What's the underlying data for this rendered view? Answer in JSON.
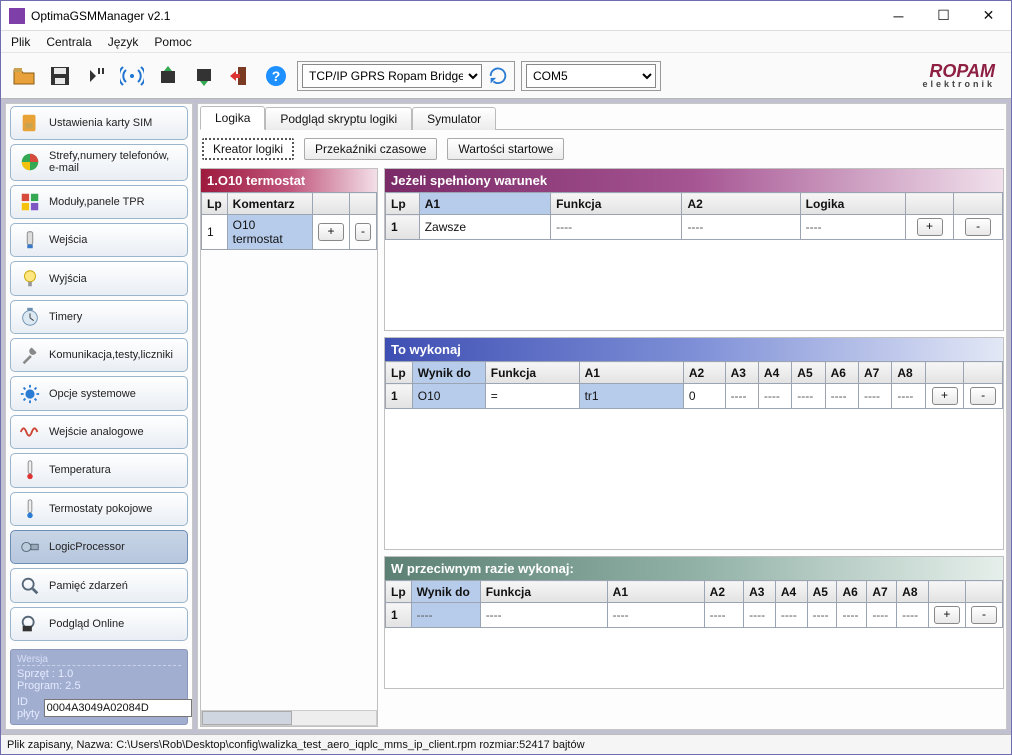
{
  "window": {
    "title": "OptimaGSMManager v2.1"
  },
  "menu": {
    "items": [
      "Plik",
      "Centrala",
      "Język",
      "Pomoc"
    ]
  },
  "toolbar": {
    "conn_select": "TCP/IP GPRS Ropam Bridge",
    "com_select": "COM5",
    "brand_top": "ROPAM",
    "brand_bot": "elektronik"
  },
  "sidebar": {
    "items": [
      "Ustawienia karty SIM",
      "Strefy,numery telefonów, e-mail",
      "Moduły,panele TPR",
      "Wejścia",
      "Wyjścia",
      "Timery",
      "Komunikacja,testy,liczniki",
      "Opcje systemowe",
      "Wejście analogowe",
      "Temperatura",
      "Termostaty pokojowe",
      "LogicProcessor",
      "Pamięć zdarzeń",
      "Podgląd Online"
    ],
    "active_index": 11
  },
  "version": {
    "group": "Wersja",
    "hw": "Sprzęt : 1.0",
    "sw": "Program: 2.5",
    "id_label": "ID płyty",
    "id_value": "0004A3049A02084D"
  },
  "tabs": {
    "names": [
      "Logika",
      "Podgląd skryptu logiki",
      "Symulator"
    ],
    "active": 0
  },
  "subtabs": {
    "names": [
      "Kreator logiki",
      "Przekaźniki czasowe",
      "Wartości startowe"
    ],
    "active": 0
  },
  "left_panel": {
    "title": "1.O10 termostat",
    "cols": [
      "Lp",
      "Komentarz"
    ],
    "row": {
      "lp": "1",
      "comment": "O10 termostat"
    }
  },
  "cond": {
    "title": "Jeżeli spełniony warunek",
    "cols": [
      "Lp",
      "A1",
      "Funkcja",
      "A2",
      "Logika"
    ],
    "row": {
      "lp": "1",
      "a1": "Zawsze",
      "fun": "----",
      "a2": "----",
      "log": "----"
    }
  },
  "then": {
    "title": "To wykonaj",
    "cols": [
      "Lp",
      "Wynik do",
      "Funkcja",
      "A1",
      "A2",
      "A3",
      "A4",
      "A5",
      "A6",
      "A7",
      "A8"
    ],
    "row": {
      "lp": "1",
      "wynik": "O10",
      "fun": "=",
      "a1": "tr1",
      "a2": "0",
      "a3": "----",
      "a4": "----",
      "a5": "----",
      "a6": "----",
      "a7": "----",
      "a8": "----"
    }
  },
  "elsep": {
    "title": "W przeciwnym razie wykonaj:",
    "cols": [
      "Lp",
      "Wynik do",
      "Funkcja",
      "A1",
      "A2",
      "A3",
      "A4",
      "A5",
      "A6",
      "A7",
      "A8"
    ],
    "row": {
      "lp": "1",
      "wynik": "----",
      "fun": "----",
      "a1": "----",
      "a2": "----",
      "a3": "----",
      "a4": "----",
      "a5": "----",
      "a6": "----",
      "a7": "----",
      "a8": "----"
    }
  },
  "status": "Plik zapisany, Nazwa: C:\\Users\\Rob\\Desktop\\config\\walizka_test_aero_iqplc_mms_ip_client.rpm rozmiar:52417 bajtów"
}
